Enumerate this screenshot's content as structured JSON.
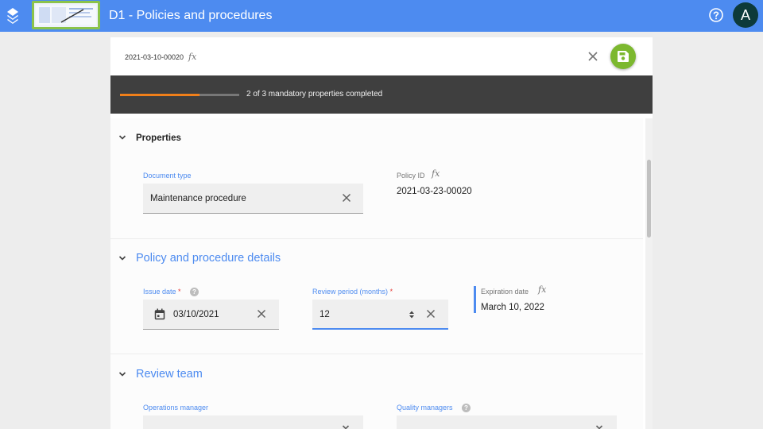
{
  "topbar": {
    "title": "D1 - Policies and procedures",
    "avatar_initial": "A",
    "icons": [
      "app-stack-icon",
      "question-circle-icon"
    ],
    "color": "#4d8bf0"
  },
  "document": {
    "id": "2021-03-10-00020",
    "formula_symbol": "fx"
  },
  "progress": {
    "text": "2 of 3 mandatory properties completed",
    "fraction": 0.667,
    "color": "#f07f1a"
  },
  "sections": {
    "properties": {
      "title": "Properties",
      "document_type_label": "Document type",
      "document_type_value": "Maintenance procedure",
      "policy_id_label": "Policy ID",
      "policy_id_value": "2021-03-23-00020"
    },
    "details": {
      "title": "Policy and procedure details",
      "issue_date_label": "Issue date",
      "issue_date_value": "03/10/2021",
      "review_period_label": "Review period (months)",
      "review_period_value": "12",
      "expiration_label": "Expiration date",
      "expiration_value": "March 10, 2022",
      "required_marker": "*",
      "help_marker": "?"
    },
    "review_team": {
      "title": "Review team",
      "operations_manager_label": "Operations manager",
      "quality_managers_label": "Quality managers"
    }
  },
  "colors": {
    "accent": "#4d8bf0",
    "save_button": "#7cb82f",
    "progress_band": "#3f3f3f",
    "required": "#e53935"
  }
}
